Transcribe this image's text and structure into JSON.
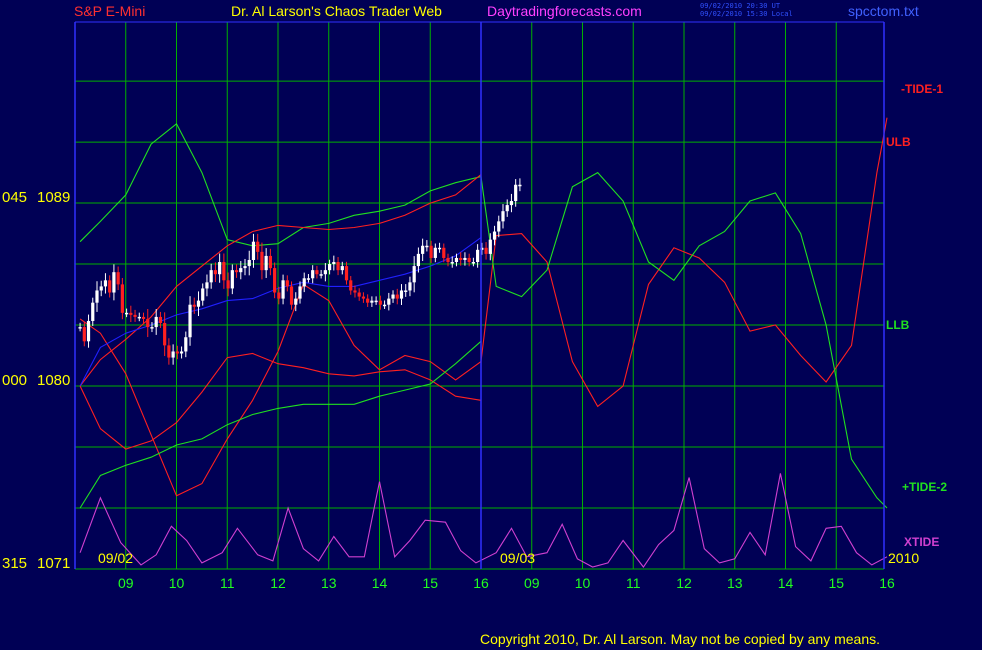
{
  "header": {
    "symbol": "S&P E-Mini",
    "title": "Dr. Al Larson's Chaos Trader Web",
    "site": "Daytradingforecasts.com",
    "stamp_ut": "09/02/2010 20:30 UT",
    "stamp_local": "09/02/2010 15:30 Local",
    "filename": "spcctom.txt"
  },
  "copyright": "Copyright 2010, Dr. Al Larson. May not be copied by any means.",
  "colors": {
    "background": "#000055",
    "grid": "#00b000",
    "frame": "#3030ff",
    "price_up": "#ffffff",
    "price_down": "#ff2020",
    "moving_avg": "#2020ff",
    "tide1": "#ff2020",
    "tide2": "#20e020",
    "xtide": "#d040d0",
    "axis_time": "#20ff20",
    "axis_value": "#ffff00"
  },
  "chart_data": {
    "type": "line",
    "title": "S&P E-Mini",
    "x_unit": "hour (day 1 = 09/02, day 2 = 09/03)",
    "day_labels": [
      "09/02",
      "09/03",
      "2010"
    ],
    "x_ticks": [
      "09",
      "10",
      "11",
      "12",
      "13",
      "14",
      "15",
      "16",
      "09",
      "10",
      "11",
      "12",
      "13",
      "14",
      "15",
      "16"
    ],
    "y_axis_labels": [
      {
        "label": "045",
        "value": "1089",
        "y": 1089
      },
      {
        "label": "000",
        "value": "1080",
        "y": 1080
      },
      {
        "label": "315",
        "value": "1071",
        "y": 1071
      }
    ],
    "ylim": [
      1071,
      1094
    ],
    "now_day": 1,
    "now_hour": 16,
    "right_labels": [
      {
        "text": "-TIDE-1",
        "y": 1093.1,
        "color": "#ff2020"
      },
      {
        "text": "ULB",
        "y": 1089.8,
        "color": "#ff2020"
      },
      {
        "text": "LLB",
        "y": 1084.8,
        "color": "#20e020"
      },
      {
        "text": "+TIDE-2",
        "y": 1074.2,
        "color": "#20e020"
      },
      {
        "text": "XTIDE",
        "y": 1072.0,
        "color": "#d040d0"
      }
    ],
    "price_bars": {
      "style": "candlestick",
      "day": 1,
      "start_hour": 8.1,
      "bar_minutes": 5,
      "closes": [
        1082.9,
        1082.2,
        1083.2,
        1084.1,
        1084.7,
        1084.9,
        1085.2,
        1084.6,
        1085.6,
        1085.0,
        1083.6,
        1083.6,
        1083.5,
        1083.4,
        1083.4,
        1083.3,
        1082.9,
        1082.9,
        1083.4,
        1083.1,
        1082.0,
        1081.4,
        1081.7,
        1081.6,
        1081.7,
        1082.4,
        1084.0,
        1083.9,
        1084.2,
        1084.8,
        1085.1,
        1085.7,
        1085.5,
        1086.1,
        1085.2,
        1084.8,
        1085.7,
        1085.6,
        1085.8,
        1085.9,
        1086.2,
        1087.1,
        1086.6,
        1085.7,
        1086.4,
        1085.8,
        1084.6,
        1084.3,
        1085.2,
        1084.9,
        1084.0,
        1084.3,
        1084.9,
        1085.3,
        1085.3,
        1085.7,
        1085.5,
        1085.5,
        1085.7,
        1086.0,
        1086.1,
        1085.7,
        1085.9,
        1085.2,
        1084.7,
        1084.6,
        1084.4,
        1084.3,
        1084.1,
        1084.2,
        1084.2,
        1084.0,
        1084.0,
        1084.3,
        1084.5,
        1084.3,
        1084.7,
        1084.7,
        1085.1,
        1085.9,
        1086.5,
        1086.9,
        1086.9,
        1086.3,
        1086.8,
        1086.8,
        1086.3,
        1086.1,
        1086.1,
        1086.3,
        1086.2,
        1086.3,
        1086.1,
        1086.1,
        1086.7,
        1086.8,
        1086.5,
        1087.2,
        1087.6,
        1088.1,
        1088.6,
        1088.9,
        1089.1,
        1089.9,
        1089.9
      ],
      "ranges": [
        0.6,
        0.7,
        0.9,
        0.7,
        1.3,
        0.8,
        1.0,
        0.7,
        1.1,
        0.8,
        0.9,
        0.6,
        1.0,
        0.7,
        0.6,
        0.6,
        1.4,
        0.7,
        1.1,
        0.7,
        1.5,
        1.0,
        1.0,
        0.8,
        0.7,
        0.8,
        1.2,
        1.0,
        1.3,
        0.7,
        1.1,
        0.9,
        1.1,
        1.2,
        1.2,
        1.1,
        0.8,
        0.8,
        1.0,
        1.0,
        1.3,
        1.1,
        1.1,
        1.3,
        1.1,
        1.0,
        0.8,
        0.8,
        0.8,
        0.7,
        0.7,
        0.9,
        0.7,
        0.8,
        0.6,
        0.7,
        0.6,
        0.6,
        1.0,
        0.6,
        0.9,
        0.7,
        0.6,
        0.6,
        0.6,
        0.7,
        0.6,
        0.6,
        0.6,
        0.6,
        0.6,
        0.7,
        0.6,
        0.8,
        0.6,
        0.8,
        0.9,
        0.9,
        0.8,
        1.4,
        0.9,
        1.0,
        0.8,
        0.7,
        0.6,
        0.7,
        0.6,
        0.6,
        0.8,
        0.6,
        0.8,
        0.8,
        0.6,
        0.6,
        0.8,
        0.7,
        0.8,
        0.9,
        0.8,
        0.8,
        1.0,
        0.8,
        1.0,
        0.8,
        0.9
      ]
    },
    "series": [
      {
        "name": "-TIDE-1",
        "color": "#ff2020",
        "x": [
          8.1,
          8.5,
          9.0,
          9.5,
          10.0,
          10.5,
          11.0,
          11.5,
          12.0,
          12.5,
          13.0,
          13.5,
          14.0,
          14.5,
          15.0,
          15.5,
          16.0,
          16.3,
          16.8,
          17.3,
          17.8,
          18.3,
          18.8,
          19.3,
          19.8,
          20.3,
          20.8,
          21.3,
          21.8,
          22.3,
          22.8,
          23.3,
          23.8,
          24.0
        ],
        "y": [
          1083.3,
          1082.6,
          1080.6,
          1077.6,
          1074.6,
          1075.2,
          1077.4,
          1079.3,
          1081.7,
          1085.0,
          1084.2,
          1082.0,
          1080.8,
          1081.5,
          1081.2,
          1080.3,
          1081.2,
          1087.4,
          1087.5,
          1086.1,
          1081.2,
          1079.0,
          1080.0,
          1085.0,
          1086.8,
          1086.3,
          1085.1,
          1082.7,
          1083.0,
          1081.5,
          1080.2,
          1082.0,
          1090.5,
          1093.2
        ]
      },
      {
        "name": "+TIDE-2",
        "color": "#20e020",
        "x": [
          8.1,
          8.5,
          9.0,
          9.5,
          10.0,
          10.5,
          11.0,
          11.5,
          12.0,
          12.5,
          13.0,
          13.5,
          14.0,
          14.5,
          15.0,
          15.5,
          16.0,
          16.3,
          16.8,
          17.3,
          17.8,
          18.3,
          18.8,
          19.3,
          19.8,
          20.3,
          20.8,
          21.3,
          21.8,
          22.3,
          22.8,
          23.3,
          23.8,
          24.0
        ],
        "y": [
          1087.1,
          1088.1,
          1089.4,
          1091.9,
          1092.9,
          1090.5,
          1087.2,
          1086.9,
          1087.0,
          1087.8,
          1088.0,
          1088.4,
          1088.6,
          1088.9,
          1089.6,
          1090.0,
          1090.3,
          1084.9,
          1084.4,
          1085.7,
          1089.8,
          1090.5,
          1089.1,
          1086.1,
          1085.2,
          1086.9,
          1087.6,
          1089.1,
          1089.5,
          1087.5,
          1083.0,
          1076.4,
          1074.5,
          1074.0
        ]
      },
      {
        "name": "XTIDE",
        "color": "#d040d0",
        "x": [
          8.1,
          8.5,
          8.9,
          9.3,
          9.6,
          9.9,
          10.2,
          10.5,
          10.9,
          11.2,
          11.6,
          11.9,
          12.2,
          12.5,
          12.8,
          13.1,
          13.4,
          13.7,
          14.0,
          14.3,
          14.6,
          14.9,
          15.3,
          15.6,
          15.9,
          16.3,
          16.6,
          16.9,
          17.3,
          17.6,
          17.9,
          18.2,
          18.5,
          18.8,
          19.2,
          19.5,
          19.8,
          20.1,
          20.4,
          20.7,
          21.0,
          21.3,
          21.6,
          21.9,
          22.2,
          22.5,
          22.8,
          23.1,
          23.4,
          23.7,
          24.0
        ],
        "y": [
          1071.8,
          1074.5,
          1072.3,
          1071.2,
          1071.7,
          1073.1,
          1072.4,
          1071.3,
          1071.8,
          1073.0,
          1071.7,
          1071.4,
          1074.0,
          1072.0,
          1071.4,
          1072.6,
          1071.6,
          1071.6,
          1075.3,
          1071.6,
          1072.4,
          1073.4,
          1073.3,
          1071.9,
          1071.3,
          1071.8,
          1073.0,
          1071.6,
          1071.8,
          1073.2,
          1071.5,
          1071.1,
          1071.3,
          1072.4,
          1071.1,
          1072.2,
          1072.9,
          1075.5,
          1072.0,
          1071.3,
          1071.5,
          1072.8,
          1071.7,
          1075.7,
          1072.1,
          1071.4,
          1073.0,
          1073.1,
          1071.8,
          1071.2,
          1071.6
        ]
      },
      {
        "name": "",
        "color": "#ff2020",
        "x": [
          8.1,
          8.5,
          9.0,
          9.5,
          10.0,
          10.5,
          11.0,
          11.5,
          12.0,
          12.5,
          13.0,
          13.5,
          14.0,
          14.5,
          15.0,
          15.5,
          16.0
        ],
        "y": [
          1080.0,
          1081.3,
          1082.3,
          1083.4,
          1084.9,
          1085.9,
          1086.9,
          1087.6,
          1087.9,
          1087.8,
          1087.7,
          1087.8,
          1088.0,
          1088.4,
          1089.0,
          1089.4,
          1090.4
        ]
      },
      {
        "name": "",
        "color": "#ff2020",
        "x": [
          8.1,
          8.5,
          9.0,
          9.5,
          10.0,
          10.5,
          11.0,
          11.5,
          12.0,
          12.5,
          13.0,
          13.5,
          14.0,
          14.5,
          15.0,
          15.5,
          16.0
        ],
        "y": [
          1080.0,
          1077.9,
          1076.9,
          1077.3,
          1078.2,
          1079.7,
          1081.4,
          1081.6,
          1081.1,
          1080.9,
          1080.6,
          1080.5,
          1080.7,
          1080.8,
          1080.3,
          1079.5,
          1079.3
        ]
      },
      {
        "name": "",
        "color": "#20e020",
        "x": [
          8.1,
          8.5,
          9.0,
          9.5,
          10.0,
          10.5,
          11.0,
          11.5,
          12.0,
          12.5,
          13.0,
          13.5,
          14.0,
          14.5,
          15.0,
          15.5,
          16.0
        ],
        "y": [
          1074.0,
          1075.6,
          1076.1,
          1076.5,
          1077.1,
          1077.4,
          1078.1,
          1078.6,
          1078.9,
          1079.1,
          1079.1,
          1079.1,
          1079.5,
          1079.8,
          1080.1,
          1081.1,
          1082.2
        ]
      },
      {
        "name": "",
        "color": "#2020ff",
        "x": [
          8.1,
          8.5,
          9.0,
          9.5,
          10.0,
          10.5,
          11.0,
          11.5,
          12.0,
          12.5,
          13.0,
          13.5,
          14.0,
          14.5,
          15.0,
          15.5,
          16.0
        ],
        "y": [
          1080.0,
          1081.9,
          1082.6,
          1083.0,
          1083.5,
          1083.8,
          1084.2,
          1084.3,
          1084.8,
          1085.1,
          1084.9,
          1084.9,
          1085.2,
          1085.5,
          1085.9,
          1086.4,
          1087.3
        ]
      }
    ]
  }
}
